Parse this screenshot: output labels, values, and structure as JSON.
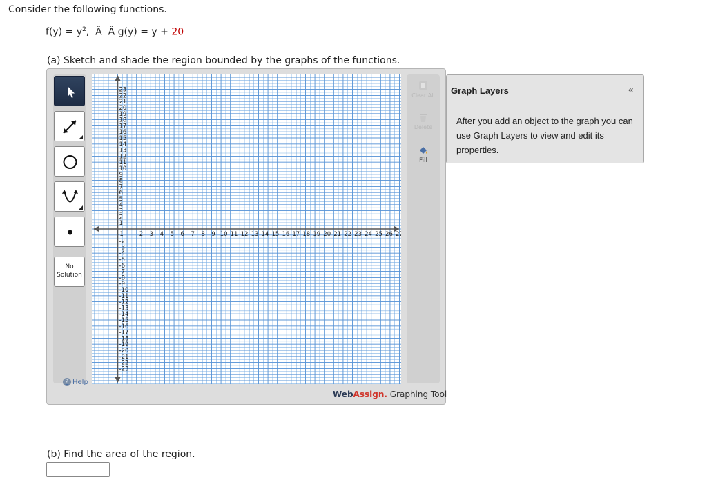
{
  "question": {
    "intro": "Consider the following functions.",
    "f_label": "f(y) = y",
    "f_exp": "2",
    "separator": ",  Â  Â ",
    "g_label": "g(y) = y + ",
    "g_const": "20",
    "part_a": "(a) Sketch and shade the region bounded by the graphs of the functions.",
    "part_b": "(b) Find the area of the region.",
    "answer_value": ""
  },
  "tool": {
    "palette": [
      {
        "name": "pointer-tool",
        "icon": "arrow-pointer-icon",
        "active": true
      },
      {
        "name": "line-tool",
        "icon": "line-segment-icon",
        "active": false
      },
      {
        "name": "circle-tool",
        "icon": "circle-icon",
        "active": false
      },
      {
        "name": "parabola-tool",
        "icon": "parabola-icon",
        "active": false
      },
      {
        "name": "point-tool",
        "icon": "point-icon",
        "active": false
      }
    ],
    "no_solution_line1": "No",
    "no_solution_line2": "Solution",
    "help_label": "Help",
    "right_buttons": {
      "clear_all": "Clear All",
      "delete": "Delete",
      "fill": "Fill"
    },
    "brand_web": "Web",
    "brand_assign": "Assign.",
    "brand_tail": " Graphing Tool",
    "axes": {
      "x_min": -1,
      "x_max": 27,
      "y_min": -23,
      "y_max": 23,
      "x_ticks": [
        -1,
        2,
        3,
        4,
        5,
        6,
        7,
        8,
        9,
        10,
        11,
        12,
        13,
        14,
        15,
        16,
        17,
        18,
        19,
        20,
        21,
        22,
        23,
        24,
        25,
        26,
        27
      ],
      "y_ticks_pos": [
        23,
        22,
        21,
        20,
        19,
        18,
        17,
        16,
        15,
        14,
        13,
        12,
        11,
        10,
        9,
        8,
        7,
        6,
        5,
        4,
        3,
        2,
        1
      ],
      "y_ticks_neg": [
        -2,
        -3,
        -4,
        -5,
        -6,
        -7,
        -8,
        -9,
        -10,
        -11,
        -12,
        -13,
        -14,
        -15,
        -16,
        -17,
        -18,
        -19,
        -20,
        -21,
        -22,
        -23
      ]
    }
  },
  "layers": {
    "title": "Graph Layers",
    "collapse_glyph": "«",
    "body": "After you add an object to the graph you can use Graph Layers to view and edit its properties."
  },
  "colors": {
    "grid_minor": "#7fb2e5",
    "grid_major": "#5a95d6",
    "axis": "#555555",
    "brand_red": "#d0352b",
    "constant_red": "#c00000"
  }
}
